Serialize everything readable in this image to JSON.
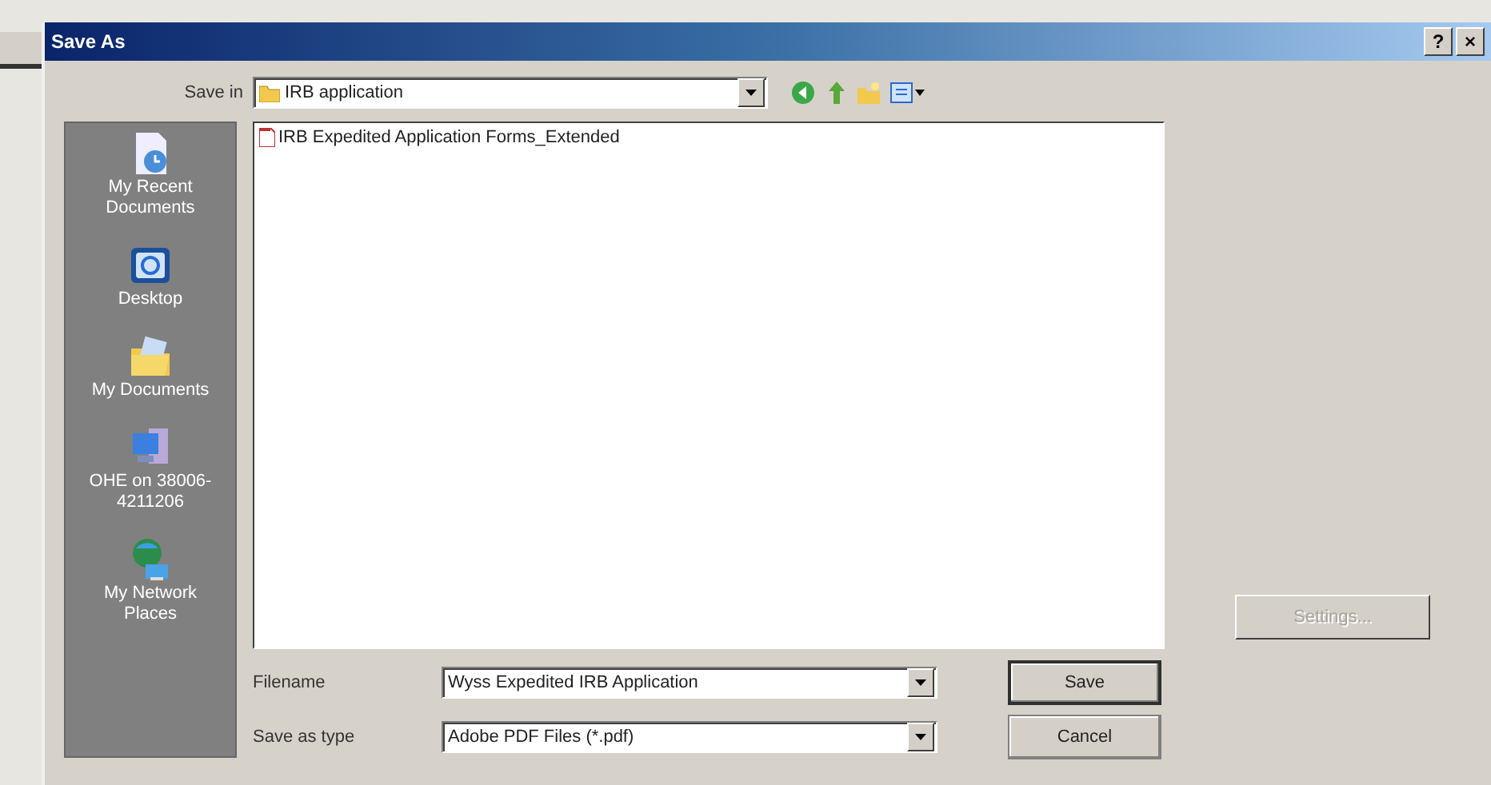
{
  "window": {
    "title": "Save As",
    "help_button": "?",
    "close_button": "×"
  },
  "save_in": {
    "label": "Save in",
    "value": "IRB application"
  },
  "places": [
    {
      "kind": "recent",
      "label": "My Recent Documents"
    },
    {
      "kind": "desktop",
      "label": "Desktop"
    },
    {
      "kind": "documents",
      "label": "My Documents"
    },
    {
      "kind": "computer",
      "label": "OHE on 38006-4211206"
    },
    {
      "kind": "network",
      "label": "My Network Places"
    }
  ],
  "files": [
    {
      "name": "IRB Expedited Application Forms_Extended",
      "selected": false
    }
  ],
  "file_name": {
    "label": "Filename",
    "value": "Wyss Expedited IRB Application"
  },
  "save_as_type": {
    "label": "Save as type",
    "value": "Adobe PDF Files (*.pdf)"
  },
  "buttons": [
    {
      "label": "Save",
      "default": true
    },
    {
      "label": "Cancel",
      "default": false
    }
  ],
  "settings_button": {
    "label": "Settings...",
    "disabled": true
  }
}
